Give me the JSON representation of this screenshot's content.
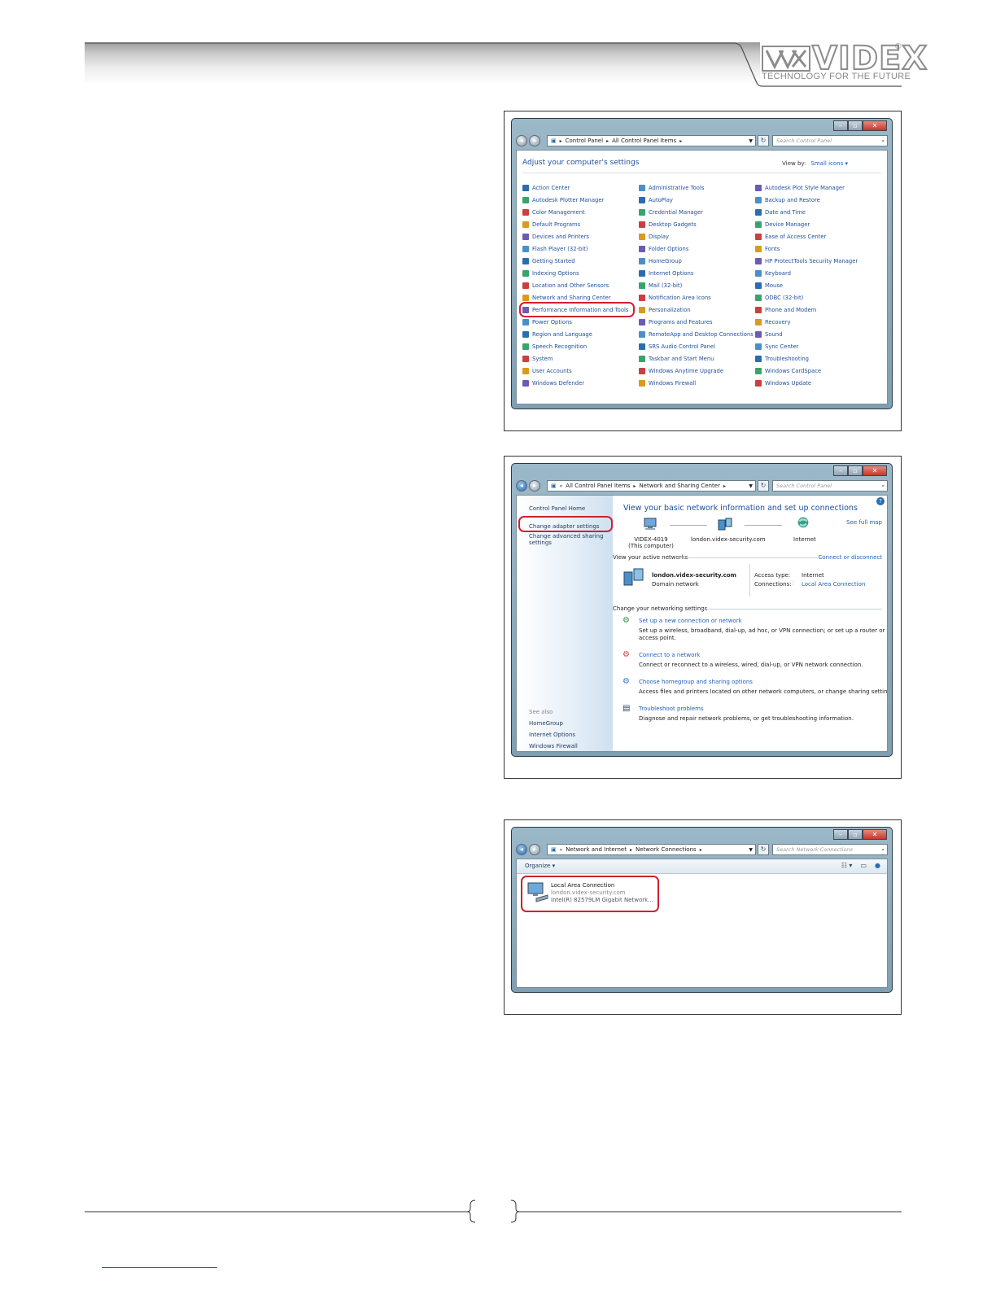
{
  "brand": {
    "logo_text": "VIDEX",
    "registered": "®",
    "tagline": "TECHNOLOGY FOR THE FUTURE",
    "logo_color": "#8c8c8c"
  },
  "screen1": {
    "breadcrumb": [
      "Control Panel",
      "All Control Panel Items"
    ],
    "search_placeholder": "Search Control Panel",
    "heading": "Adjust your computer's settings",
    "view_by_label": "View by:",
    "view_by_value": "Small icons ▾",
    "columns": [
      [
        "Action Center",
        "Autodesk Plotter Manager",
        "Color Management",
        "Default Programs",
        "Devices and Printers",
        "Flash Player (32-bit)",
        "Getting Started",
        "Indexing Options",
        "Location and Other Sensors",
        "Network and Sharing Center",
        "Performance Information and Tools",
        "Power Options",
        "Region and Language",
        "Speech Recognition",
        "System",
        "User Accounts",
        "Windows Defender"
      ],
      [
        "Administrative Tools",
        "AutoPlay",
        "Credential Manager",
        "Desktop Gadgets",
        "Display",
        "Folder Options",
        "HomeGroup",
        "Internet Options",
        "Mail (32-bit)",
        "Notification Area Icons",
        "Personalization",
        "Programs and Features",
        "RemoteApp and Desktop Connections",
        "SRS Audio Control Panel",
        "Taskbar and Start Menu",
        "Windows Anytime Upgrade",
        "Windows Firewall"
      ],
      [
        "Autodesk Plot Style Manager",
        "Backup and Restore",
        "Date and Time",
        "Device Manager",
        "Ease of Access Center",
        "Fonts",
        "HP ProtectTools Security Manager",
        "Keyboard",
        "Mouse",
        "ODBC (32-bit)",
        "Phone and Modem",
        "Recovery",
        "Sound",
        "Sync Center",
        "Troubleshooting",
        "Windows CardSpace",
        "Windows Update"
      ]
    ],
    "highlighted": "Network and Sharing Center"
  },
  "screen2": {
    "breadcrumb": [
      "All Control Panel Items",
      "Network and Sharing Center"
    ],
    "search_placeholder": "Search Control Panel",
    "side": {
      "home": "Control Panel Home",
      "adapter": "Change adapter settings",
      "advanced": "Change advanced sharing settings",
      "see_also": "See also",
      "links": [
        "HomeGroup",
        "Internet Options",
        "Windows Firewall"
      ]
    },
    "heading": "View your basic network information and set up connections",
    "see_full_map": "See full map",
    "map": {
      "computer": "VIDEX-4019",
      "computer_sub": "(This computer)",
      "domain": "london.videx-security.com",
      "internet": "Internet"
    },
    "active_networks_label": "View your active networks",
    "connect_disconnect": "Connect or disconnect",
    "network_name": "london.videx-security.com",
    "network_type": "Domain network",
    "access_type_label": "Access type:",
    "access_type_value": "Internet",
    "connections_label": "Connections:",
    "connections_value": "Local Area Connection",
    "change_settings_label": "Change your networking settings",
    "tasks": [
      {
        "title": "Set up a new connection or network",
        "desc": "Set up a wireless, broadband, dial-up, ad hoc, or VPN connection; or set up a router or",
        "desc2": "access point."
      },
      {
        "title": "Connect to a network",
        "desc": "Connect or reconnect to a wireless, wired, dial-up, or VPN network connection.",
        "desc2": ""
      },
      {
        "title": "Choose homegroup and sharing options",
        "desc": "Access files and printers located on other network computers, or change sharing settings.",
        "desc2": ""
      },
      {
        "title": "Troubleshoot problems",
        "desc": "Diagnose and repair network problems, or get troubleshooting information.",
        "desc2": ""
      }
    ]
  },
  "screen3": {
    "breadcrumb": [
      "Network and Internet",
      "Network Connections"
    ],
    "search_placeholder": "Search Network Connections",
    "organize": "Organize ▾",
    "connection_name": "Local Area Connection",
    "connection_domain": "london.videx-security.com",
    "connection_adapter": "Intel(R) 82579LM Gigabit Network..."
  },
  "colors": {
    "highlight_red": "#d02030",
    "link_blue": "#1e5ebd"
  }
}
